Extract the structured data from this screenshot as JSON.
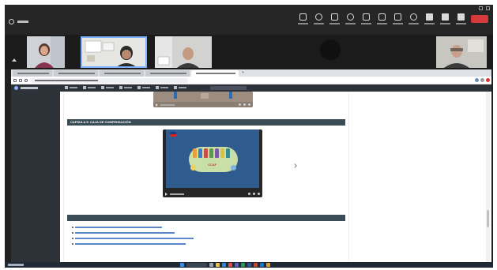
{
  "meeting": {
    "window_title": "",
    "participant_names": [
      "",
      ""
    ],
    "toolbar": [
      {
        "name": "chat",
        "label": ""
      },
      {
        "name": "people",
        "label": ""
      },
      {
        "name": "raise-hand",
        "label": ""
      },
      {
        "name": "react",
        "label": ""
      },
      {
        "name": "view",
        "label": ""
      },
      {
        "name": "rooms",
        "label": ""
      },
      {
        "name": "apps",
        "label": ""
      },
      {
        "name": "more",
        "label": ""
      },
      {
        "name": "camera",
        "label": ""
      },
      {
        "name": "mic",
        "label": ""
      },
      {
        "name": "share",
        "label": ""
      }
    ],
    "leave_label": "",
    "colors": {
      "leave": "#d43a3a",
      "selected_tile": "#7fb0ff"
    }
  },
  "browser": {
    "tabs": [
      "",
      "",
      "",
      "",
      ""
    ],
    "url": "",
    "site": {
      "name": "",
      "menu": [
        "",
        "",
        "",
        "",
        "",
        "",
        ""
      ],
      "search": ""
    },
    "page": {
      "section_caja": "CAPSULA 5: CAJA DE COMPENSACIÓN",
      "section_beneficios": "",
      "slide_title": "",
      "slide_label": "CCAF",
      "links": [
        "",
        "",
        "",
        ""
      ]
    }
  },
  "taskbar": {
    "user": "",
    "clock": ""
  }
}
